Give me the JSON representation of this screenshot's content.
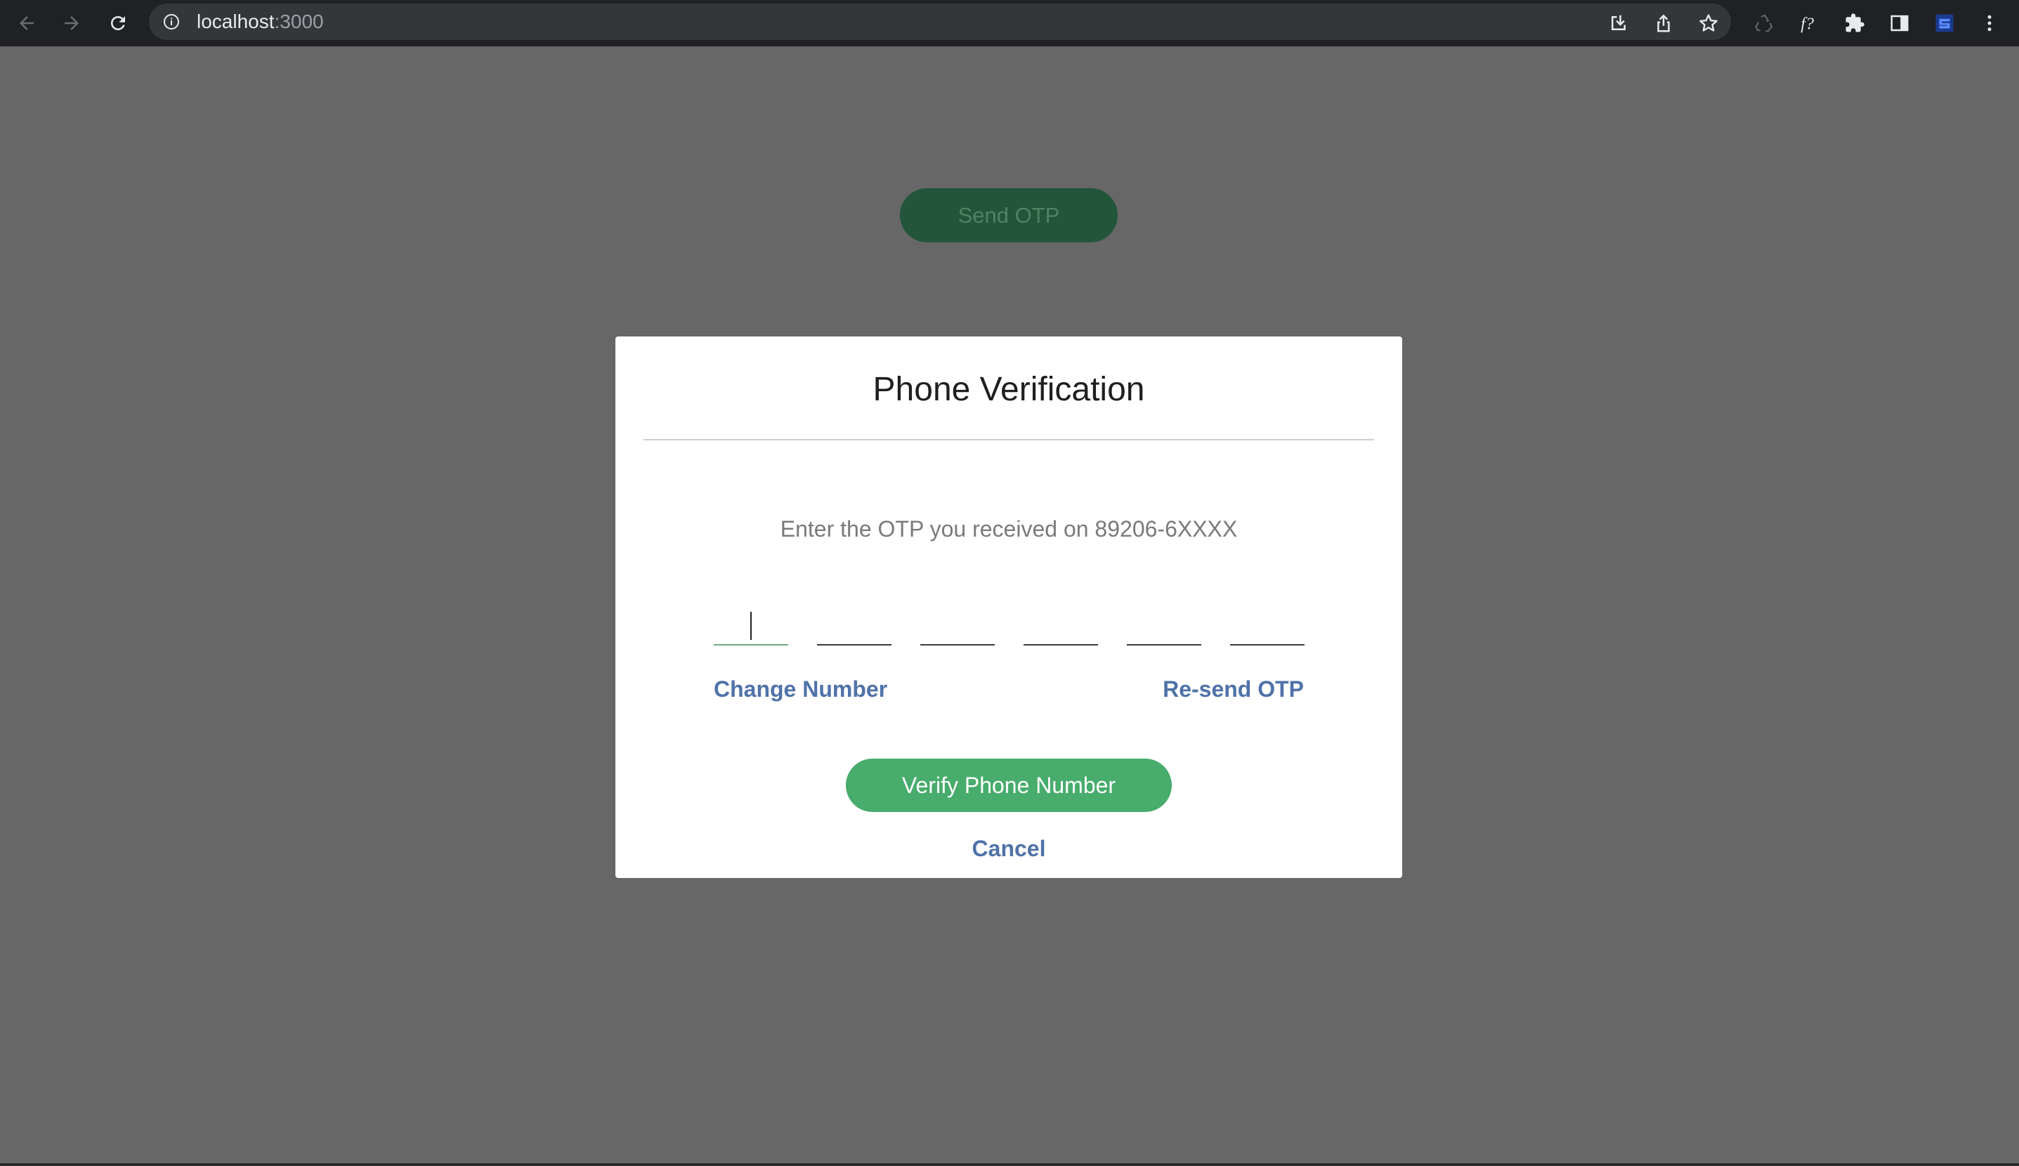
{
  "browser": {
    "url_host": "localhost",
    "url_port": ":3000",
    "icons": [
      "back-icon",
      "forward-icon",
      "reload-icon",
      "info-icon",
      "install-icon",
      "share-icon",
      "bookmark-star-icon",
      "extension-recycle-icon",
      "extension-font-icon",
      "extensions-puzzle-icon",
      "side-panel-icon",
      "extension-g-icon",
      "more-menu-icon"
    ]
  },
  "background": {
    "send_otp_label": "Send OTP"
  },
  "modal": {
    "title": "Phone Verification",
    "subtitle": "Enter the OTP you received on 89206-6XXXX",
    "otp_digits": [
      "",
      "",
      "",
      "",
      "",
      ""
    ],
    "change_number_label": "Change Number",
    "resend_label": "Re-send OTP",
    "verify_label": "Verify Phone Number",
    "cancel_label": "Cancel"
  },
  "colors": {
    "overlay": "#676767",
    "chrome": "#202124",
    "omnibox": "#35363a",
    "verify_button": "#48ac6c",
    "link": "#4f72a8",
    "send_otp_dimmed": "#22553a"
  }
}
